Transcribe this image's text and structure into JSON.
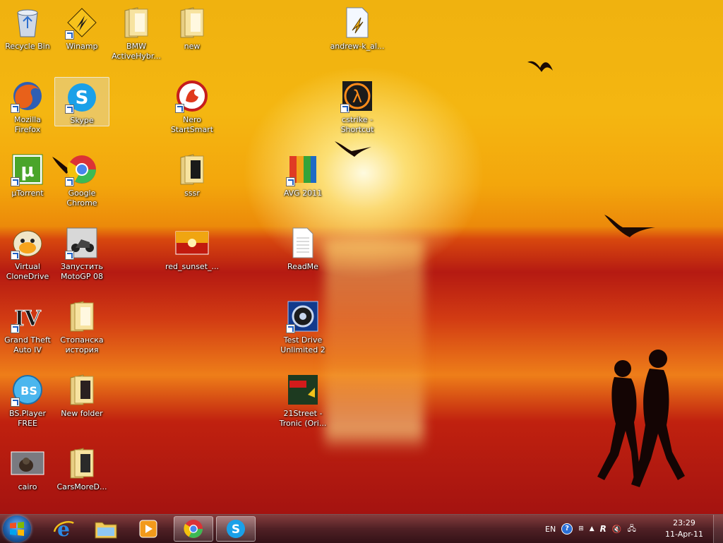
{
  "desktop_icons": [
    {
      "label": "Recycle Bin",
      "icon": "recycle-bin-icon"
    },
    {
      "label": "Winamp",
      "icon": "winamp-icon"
    },
    {
      "label": "BMW\nActiveHybr...",
      "icon": "folder-icon"
    },
    {
      "label": "new",
      "icon": "folder-icon"
    },
    {
      "label": "andrew-k_al...",
      "icon": "audio-file-icon"
    },
    {
      "label": "Mozilla\nFirefox",
      "icon": "firefox-icon"
    },
    {
      "label": "Skype",
      "icon": "skype-icon"
    },
    {
      "label": "Nero\nStartSmart",
      "icon": "nero-icon"
    },
    {
      "label": "cstrike -\nShortcut",
      "icon": "half-life-icon"
    },
    {
      "label": "µTorrent",
      "icon": "utorrent-icon"
    },
    {
      "label": "Google\nChrome",
      "icon": "chrome-icon"
    },
    {
      "label": "sssr",
      "icon": "folder-icon"
    },
    {
      "label": "AVG 2011",
      "icon": "avg-icon"
    },
    {
      "label": "Virtual\nCloneDrive",
      "icon": "virtual-clonedrive-icon"
    },
    {
      "label": "Запустить\nMotoGP 08",
      "icon": "motogp-icon"
    },
    {
      "label": "red_sunset_...",
      "icon": "image-file-icon"
    },
    {
      "label": "ReadMe",
      "icon": "text-file-icon"
    },
    {
      "label": "Grand Theft\nAuto IV",
      "icon": "gta-iv-icon"
    },
    {
      "label": "Стопанска\nистория",
      "icon": "folder-icon"
    },
    {
      "label": "Test Drive\nUnlimited 2",
      "icon": "test-drive-icon"
    },
    {
      "label": "BS.Player\nFREE",
      "icon": "bsplayer-icon"
    },
    {
      "label": "New folder",
      "icon": "folder-icon"
    },
    {
      "label": "21Street -\nTronic (Ori...",
      "icon": "topmusic-icon"
    },
    {
      "label": "cairo",
      "icon": "image-file-icon"
    },
    {
      "label": "CarsMoreD...",
      "icon": "folder-icon"
    }
  ],
  "taskbar": {
    "start_icon": "windows-logo-icon",
    "pinned": [
      {
        "name": "internet-explorer-icon"
      },
      {
        "name": "windows-explorer-icon"
      },
      {
        "name": "media-player-icon"
      },
      {
        "name": "chrome-icon",
        "active": true
      },
      {
        "name": "skype-icon",
        "active": true
      }
    ],
    "tray": {
      "language": "EN",
      "help_icon": "help-icon",
      "expand_icon": "show-hidden-icons",
      "arrow_icon": "up-arrow-icon",
      "rockstar_icon": "rockstar-icon",
      "volume_icon": "volume-muted-icon",
      "network_icon": "network-icon"
    },
    "clock": {
      "time": "23:29",
      "date": "11-Apr-11"
    }
  },
  "colors": {
    "sky": "#f4b611",
    "sea": "#b51a12",
    "taskbar": "#46101a",
    "selection": "#dce6f0"
  }
}
